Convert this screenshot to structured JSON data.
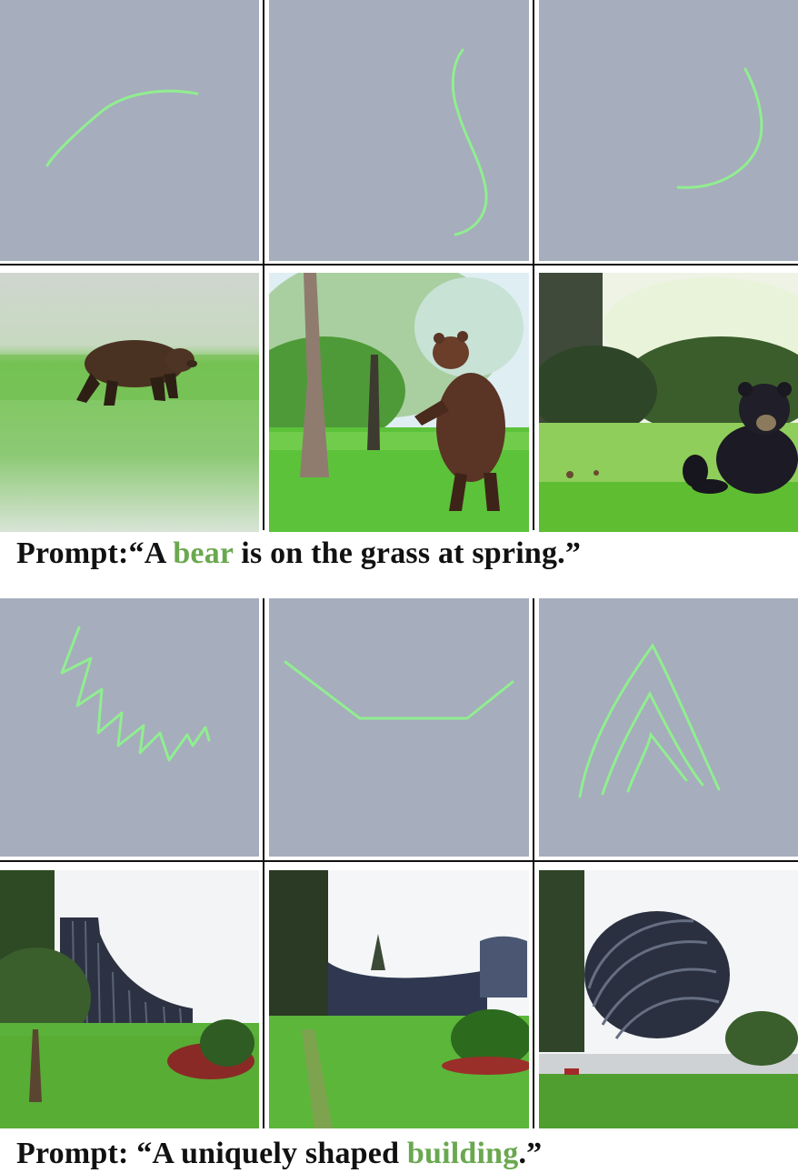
{
  "colors": {
    "sketch_background": "#a6adbc",
    "stroke": "#90ee90",
    "highlight_text": "#6aa84f"
  },
  "figure": {
    "groups": [
      {
        "sketches": [
          {
            "icon": "arc-stroke-sketch"
          },
          {
            "icon": "s-curve-stroke-sketch"
          },
          {
            "icon": "j-hook-stroke-sketch"
          }
        ],
        "images": [
          {
            "icon": "bear-walking-on-grass-image"
          },
          {
            "icon": "bear-standing-by-tree-image"
          },
          {
            "icon": "black-bear-sitting-on-lawn-image"
          }
        ],
        "caption": {
          "label": "Prompt:",
          "open_quote": "“A ",
          "highlight": "bear",
          "rest": " is on the grass at spring.",
          "close_quote": "”"
        }
      },
      {
        "sketches": [
          {
            "icon": "zigzag-stroke-sketch"
          },
          {
            "icon": "flat-v-stroke-sketch"
          },
          {
            "icon": "nested-chevrons-stroke-sketch"
          }
        ],
        "images": [
          {
            "icon": "ramp-building-image"
          },
          {
            "icon": "curved-roof-building-image"
          },
          {
            "icon": "egg-shaped-building-image"
          }
        ],
        "caption": {
          "label": "Prompt: ",
          "open_quote": "“A uniquely shaped ",
          "highlight": "building",
          "rest": ".",
          "close_quote": "”"
        }
      }
    ]
  }
}
